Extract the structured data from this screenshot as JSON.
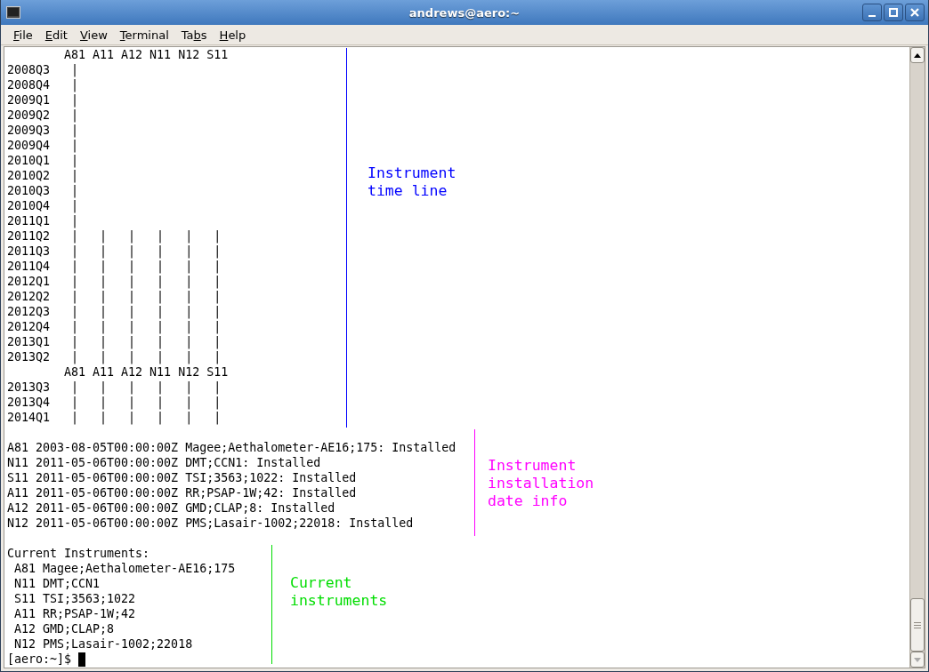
{
  "window": {
    "title": "andrews@aero:~"
  },
  "menu": [
    {
      "key": "F",
      "after": "ile"
    },
    {
      "key": "E",
      "after": "dit"
    },
    {
      "key": "V",
      "after": "iew"
    },
    {
      "key": "T",
      "after": "erminal"
    },
    {
      "before": "Ta",
      "key": "b",
      "after": "s"
    },
    {
      "key": "H",
      "after": "elp"
    }
  ],
  "terminal": {
    "sections": [
      [
        "        A81 A11 A12 N11 N12 S11",
        "2008Q3   |",
        "2008Q4   |",
        "2009Q1   |",
        "2009Q2   |",
        "2009Q3   |",
        "2009Q4   |",
        "2010Q1   |",
        "2010Q2   |",
        "2010Q3   |",
        "2010Q4   |",
        "2011Q1   |",
        "2011Q2   |   |   |   |   |   |",
        "2011Q3   |   |   |   |   |   |",
        "2011Q4   |   |   |   |   |   |",
        "2012Q1   |   |   |   |   |   |",
        "2012Q2   |   |   |   |   |   |",
        "2012Q3   |   |   |   |   |   |",
        "2012Q4   |   |   |   |   |   |",
        "2013Q1   |   |   |   |   |   |",
        "2013Q2   |   |   |   |   |   |",
        "        A81 A11 A12 N11 N12 S11",
        "2013Q3   |   |   |   |   |   |",
        "2013Q4   |   |   |   |   |   |",
        "2014Q1   |   |   |   |   |   |"
      ],
      [
        "A81 2003-08-05T00:00:00Z Magee;Aethalometer-AE16;175: Installed",
        "N11 2011-05-06T00:00:00Z DMT;CCN1: Installed",
        "S11 2011-05-06T00:00:00Z TSI;3563;1022: Installed",
        "A11 2011-05-06T00:00:00Z RR;PSAP-1W;42: Installed",
        "A12 2011-05-06T00:00:00Z GMD;CLAP;8: Installed",
        "N12 2011-05-06T00:00:00Z PMS;Lasair-1002;22018: Installed"
      ],
      [
        "Current Instruments:",
        " A81 Magee;Aethalometer-AE16;175",
        " N11 DMT;CCN1",
        " S11 TSI;3563;1022",
        " A11 RR;PSAP-1W;42",
        " A12 GMD;CLAP;8",
        " N12 PMS;Lasair-1002;22018"
      ]
    ],
    "prompt": "[aero:~]$"
  },
  "annotations": [
    {
      "text": "Instrument\ntime line",
      "color": "#0000ff"
    },
    {
      "text": "Instrument\ninstallation\ndate info",
      "color": "#ff00ff"
    },
    {
      "text": "Current\ninstruments",
      "color": "#00dd00"
    }
  ]
}
